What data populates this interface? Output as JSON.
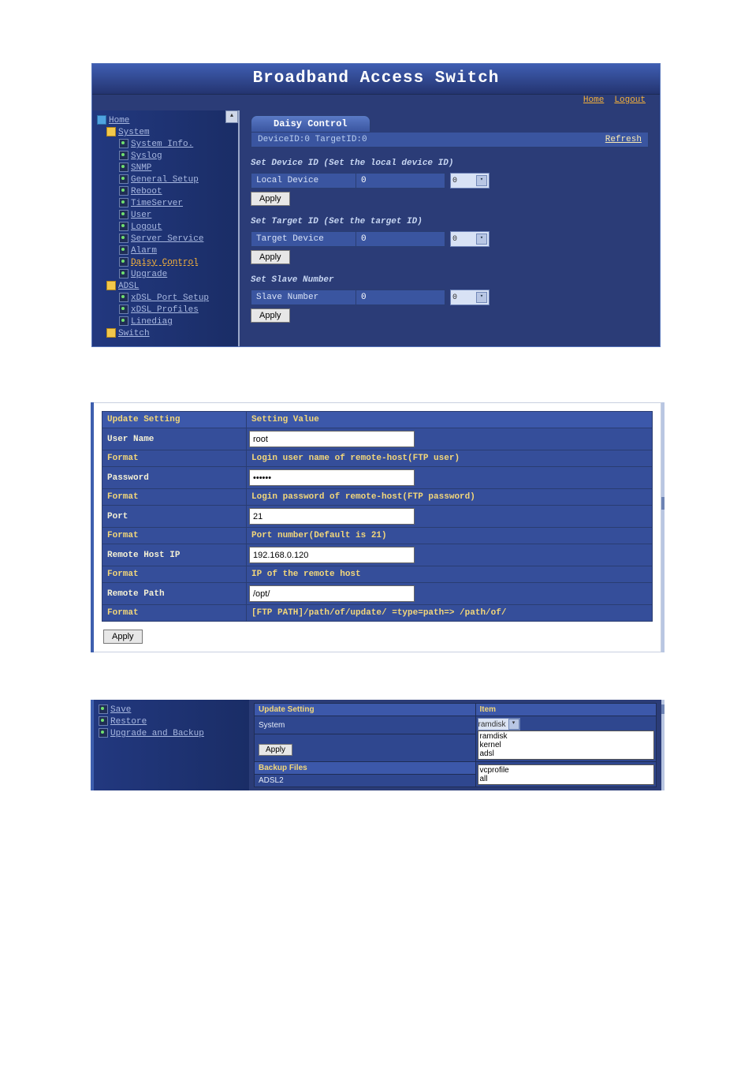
{
  "shot1": {
    "banner": "Broadband Access Switch",
    "links": {
      "home": "Home",
      "logout": "Logout"
    },
    "tree": {
      "home": "Home",
      "system": "System",
      "system_children": [
        "System Info.",
        "Syslog",
        "SNMP",
        "General Setup",
        "Reboot",
        "TimeServer",
        "User",
        "Logout",
        "Server Service",
        "Alarm",
        "Daisy Control",
        "Upgrade"
      ],
      "daisy_idx": 10,
      "adsl": "ADSL",
      "adsl_children": [
        "xDSL Port Setup",
        "xDSL Profiles",
        "Linediag"
      ],
      "switch": "Switch"
    },
    "page": {
      "title": "Daisy Control",
      "status": "DeviceID:0 TargetID:0",
      "refresh": "Refresh",
      "sect1": "Set Device ID (Set the local device ID)",
      "local_label": "Local Device",
      "local_value": "0",
      "local_sel": "0",
      "sect2": "Set Target ID (Set the target ID)",
      "target_label": "Target Device",
      "target_value": "0",
      "target_sel": "0",
      "sect3": "Set Slave Number",
      "slave_label": "Slave Number",
      "slave_value": "0",
      "slave_sel": "0",
      "apply": "Apply"
    }
  },
  "shot2": {
    "head_left": "Update Setting",
    "head_right": "Setting Value",
    "rows": {
      "user_lbl": "User Name",
      "user_val": "root",
      "user_fmt_lbl": "Format",
      "user_fmt": "Login user name of remote-host(FTP user)",
      "pass_lbl": "Password",
      "pass_val": "••••••",
      "pass_fmt_lbl": "Format",
      "pass_fmt": "Login password of remote-host(FTP password)",
      "port_lbl": "Port",
      "port_val": "21",
      "port_fmt_lbl": "Format",
      "port_fmt": "Port number(Default is 21)",
      "host_lbl": "Remote Host IP",
      "host_val": "192.168.0.120",
      "host_fmt_lbl": "Format",
      "host_fmt": "IP of the remote host",
      "path_lbl": "Remote Path",
      "path_val": "/opt/",
      "path_fmt_lbl": "Format",
      "path_fmt": "[FTP PATH]/path/of/update/ =type=path=> /path/of/"
    },
    "apply": "Apply"
  },
  "shot3": {
    "nav": [
      "Save",
      "Restore",
      "Upgrade and Backup"
    ],
    "head_left": "Update Setting",
    "head_right": "Item",
    "system_lbl": "System",
    "system_sel": "ramdisk",
    "system_opts": [
      "ramdisk",
      "kernel",
      "adsl"
    ],
    "apply": "Apply",
    "backup_head": "Backup Files",
    "backup_val": "ADSL2",
    "backup_opts": [
      "vcprofile",
      "all"
    ]
  }
}
